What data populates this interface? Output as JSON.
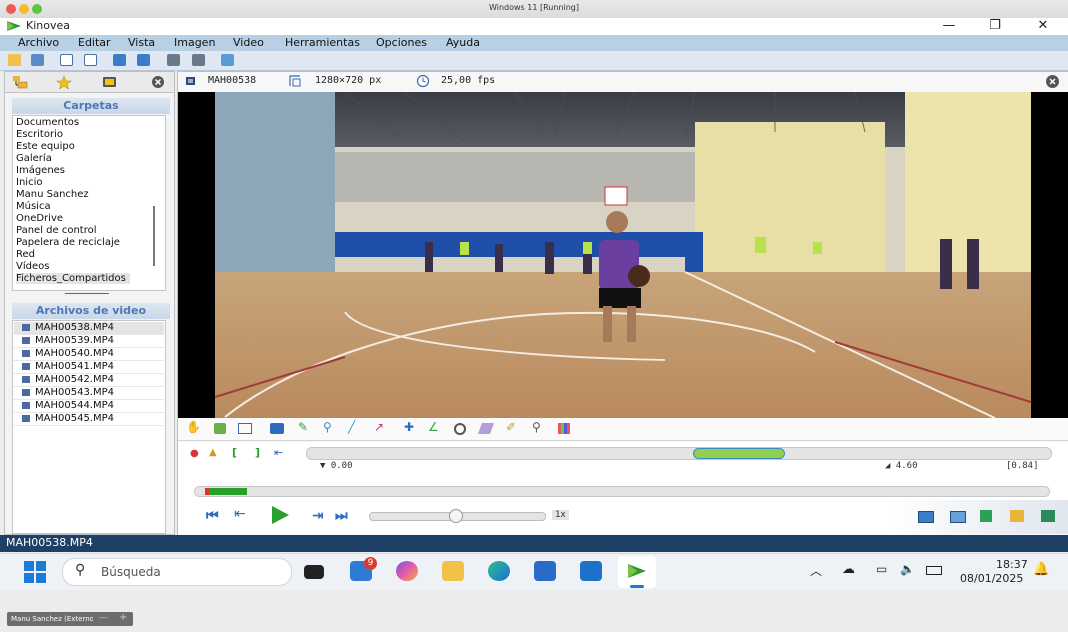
{
  "mac": {
    "window_title": "Windows 11 [Running]"
  },
  "app": {
    "title": "Kinovea",
    "controls": {
      "minimize": "—",
      "maximize": "❐",
      "close": "✕"
    },
    "menu": [
      "Archivo",
      "Editar",
      "Vista",
      "Imagen",
      "Video",
      "Herramientas",
      "Opciones",
      "Ayuda"
    ]
  },
  "sidebar": {
    "folders_header": "Carpetas",
    "folders": [
      "Documentos",
      "Escritorio",
      "Este equipo",
      "Galería",
      "Imágenes",
      "Inicio",
      "Manu Sanchez",
      "Música",
      "OneDrive",
      "Panel de control",
      "Papelera de reciclaje",
      "Red",
      "Vídeos",
      "Ficheros_Compartidos"
    ],
    "files_header": "Archivos de video",
    "files": [
      "MAH00538.MP4",
      "MAH00539.MP4",
      "MAH00540.MP4",
      "MAH00541.MP4",
      "MAH00542.MP4",
      "MAH00543.MP4",
      "MAH00544.MP4",
      "MAH00545.MP4"
    ]
  },
  "player": {
    "filename": "MAH00538",
    "resolution": "1280×720 px",
    "fps": "25,00 fps",
    "time_start": "0.00",
    "time_end": "4.60",
    "duration": "[0.84]",
    "speed": "1x"
  },
  "statusbar": {
    "text": "MAH00538.MP4"
  },
  "taskbar": {
    "search_placeholder": "Búsqueda",
    "badge": "9",
    "time": "18:37",
    "date": "08/01/2025"
  },
  "vm": {
    "label": "Manu Sanchez (Externo)",
    "btn_minus": "—",
    "btn_plus": "+"
  }
}
